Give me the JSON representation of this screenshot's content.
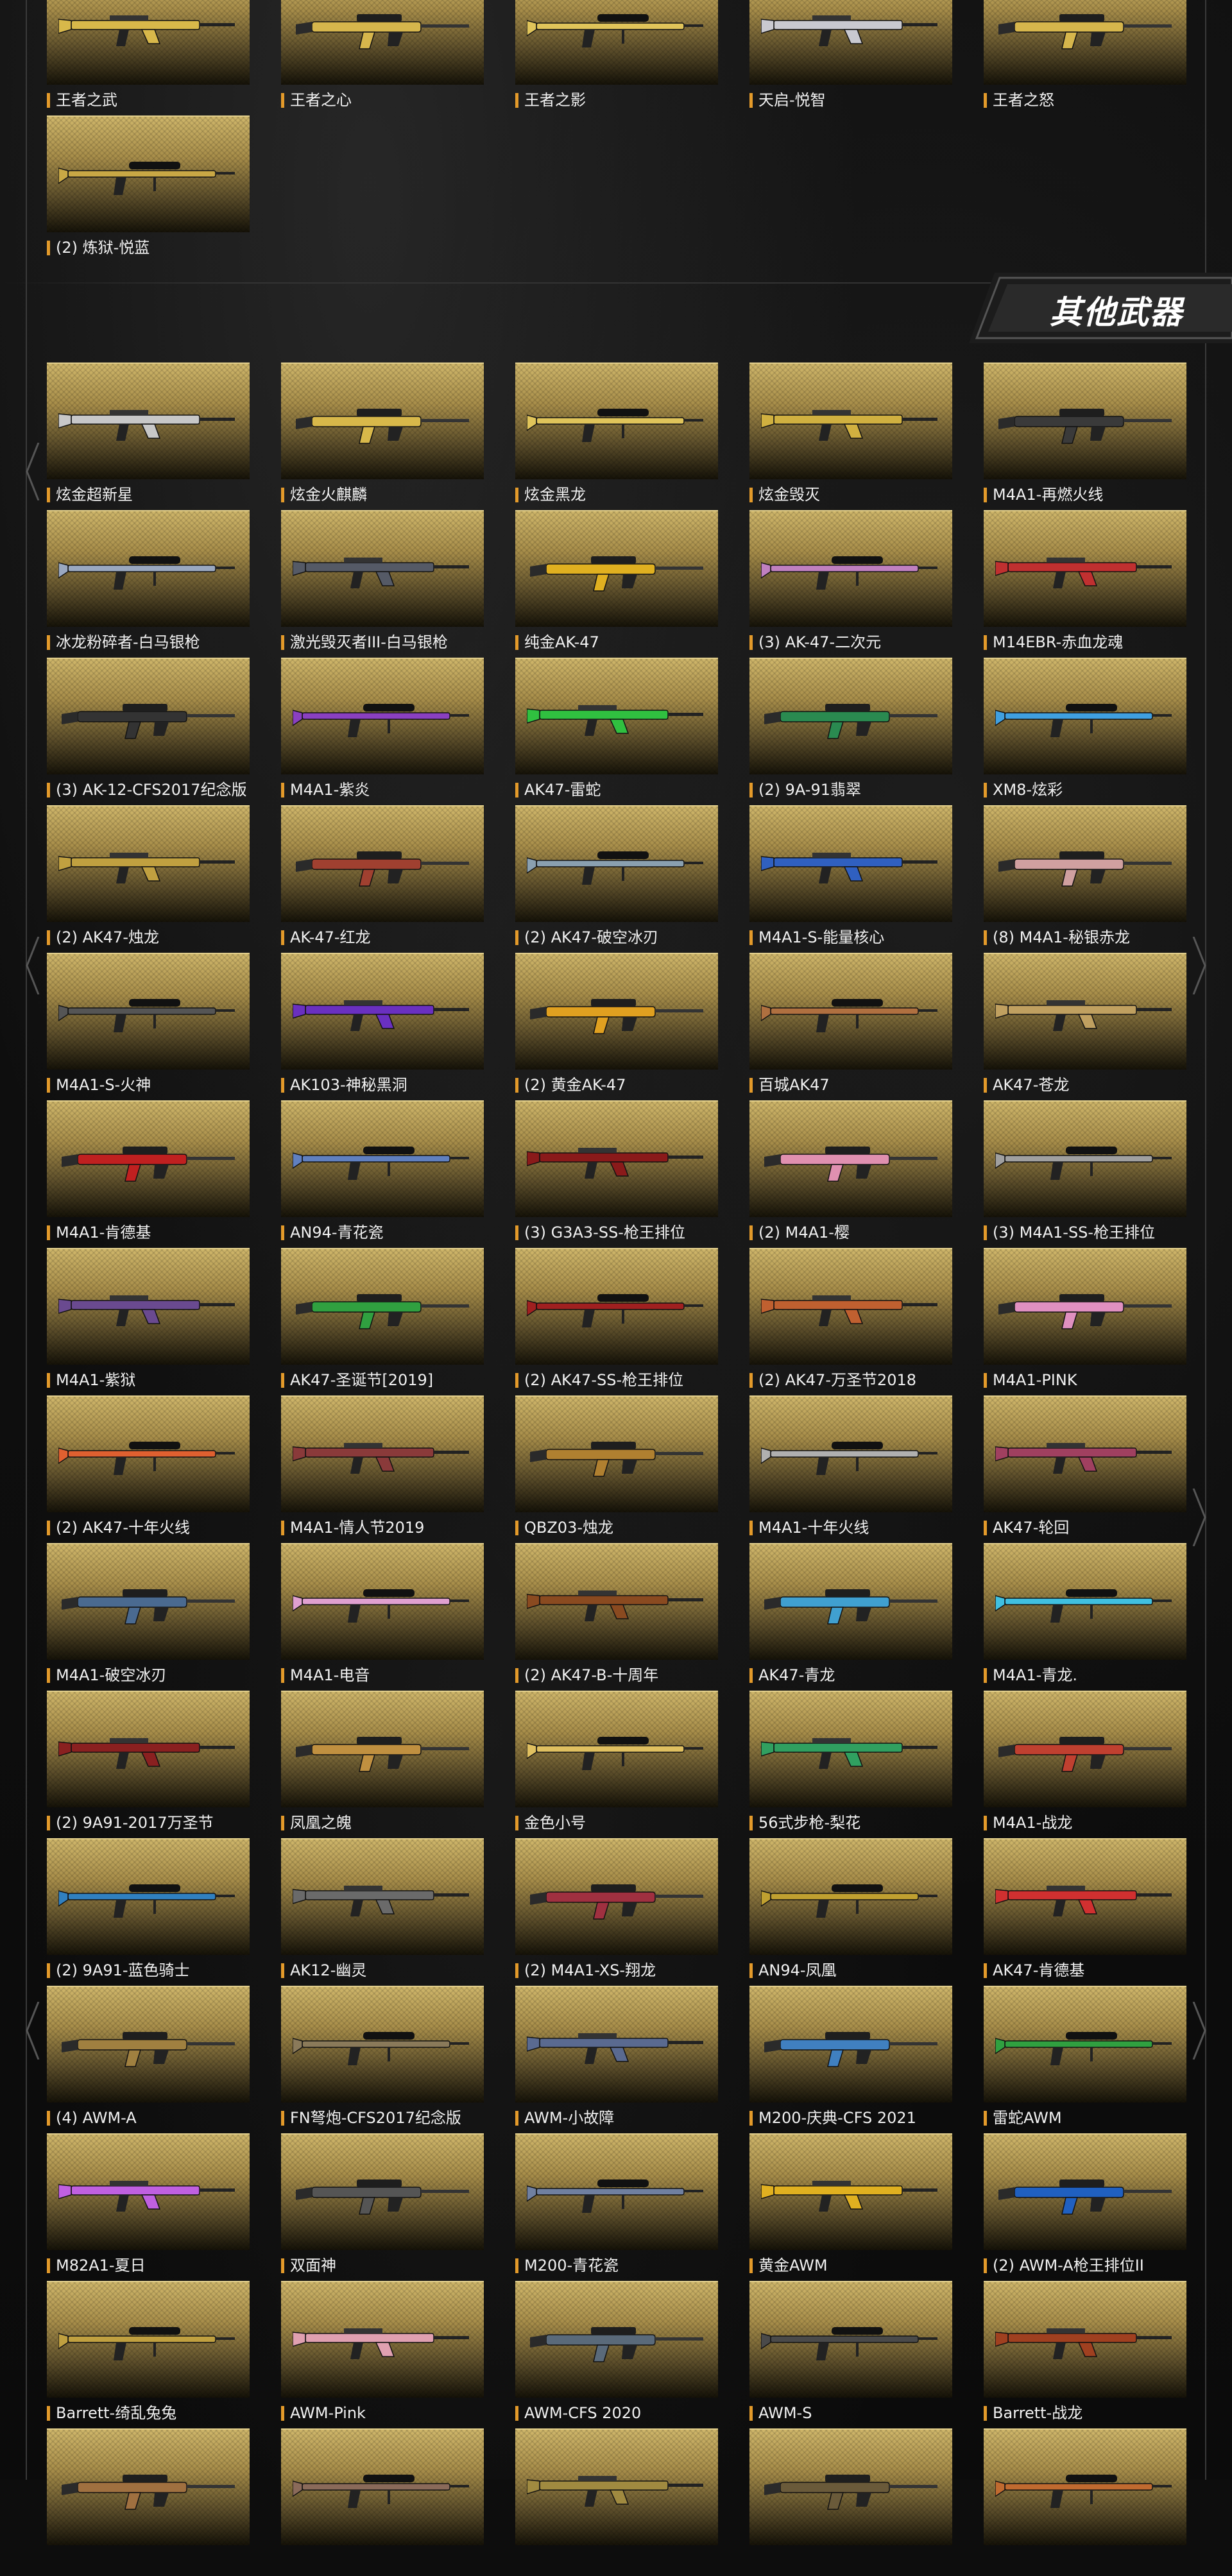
{
  "section_title": "其他武器",
  "colors": {
    "accent": "#e39a2a",
    "card_gold": "#bfa35a",
    "background": "#0d0d0d"
  },
  "top_weapons": [
    {
      "name": "王者之武",
      "color": "#d8b84a"
    },
    {
      "name": "王者之心",
      "color": "#d6b64c"
    },
    {
      "name": "王者之影",
      "color": "#e0c45a"
    },
    {
      "name": "天启-悦智",
      "color": "#c9c9d0"
    },
    {
      "name": "王者之怒",
      "color": "#d6b64c"
    },
    {
      "name": "(2) 炼狱-悦蓝",
      "color": "#c9a845"
    }
  ],
  "other_weapons": [
    {
      "name": "炫金超新星",
      "color": "#c8c8c8"
    },
    {
      "name": "炫金火麒麟",
      "color": "#d8b84a"
    },
    {
      "name": "炫金黑龙",
      "color": "#e0c45a"
    },
    {
      "name": "炫金毁灭",
      "color": "#d0b040"
    },
    {
      "name": "M4A1-再燃火线",
      "color": "#3a3a3a"
    },
    {
      "name": "冰龙粉碎者-白马银枪",
      "color": "#9aa8c0"
    },
    {
      "name": "激光毁灭者III-白马银枪",
      "color": "#555a66"
    },
    {
      "name": "纯金AK-47",
      "color": "#e0b020"
    },
    {
      "name": "(3) AK-47-二次元",
      "color": "#c080c0"
    },
    {
      "name": "M14EBR-赤血龙魂",
      "color": "#c03030"
    },
    {
      "name": "(3) AK-12-CFS2017纪念版",
      "color": "#333333"
    },
    {
      "name": "M4A1-紫炎",
      "color": "#8a40c0"
    },
    {
      "name": "AK47-雷蛇",
      "color": "#30c040"
    },
    {
      "name": "(2) 9A-91翡翠",
      "color": "#2a8a50"
    },
    {
      "name": "XM8-炫彩",
      "color": "#40a0e0"
    },
    {
      "name": "(2) AK47-烛龙",
      "color": "#c0a040"
    },
    {
      "name": "AK-47-红龙",
      "color": "#a04030"
    },
    {
      "name": "(2) AK47-破空冰刃",
      "color": "#8aa0b0"
    },
    {
      "name": "M4A1-S-能量核心",
      "color": "#3060c0"
    },
    {
      "name": "(8) M4A1-秘银赤龙",
      "color": "#d0a0a0"
    },
    {
      "name": "M4A1-S-火神",
      "color": "#555555"
    },
    {
      "name": "AK103-神秘黑洞",
      "color": "#6a30c0"
    },
    {
      "name": "(2) 黄金AK-47",
      "color": "#e0a020"
    },
    {
      "name": "百城AK47",
      "color": "#b07040"
    },
    {
      "name": "AK47-苍龙",
      "color": "#c0a060"
    },
    {
      "name": "M4A1-肯德基",
      "color": "#c02020"
    },
    {
      "name": "AN94-青花瓷",
      "color": "#6080c0"
    },
    {
      "name": "(3) G3A3-SS-枪王排位",
      "color": "#8a1a1a"
    },
    {
      "name": "(2) M4A1-樱",
      "color": "#e090b0"
    },
    {
      "name": "(3) M4A1-SS-枪王排位",
      "color": "#a0a0a0"
    },
    {
      "name": "M4A1-紫狱",
      "color": "#6a4a90"
    },
    {
      "name": "AK47-圣诞节[2019]",
      "color": "#30a040"
    },
    {
      "name": "(2) AK47-SS-枪王排位",
      "color": "#a02020"
    },
    {
      "name": "(2) AK47-万圣节2018",
      "color": "#c06030"
    },
    {
      "name": "M4A1-PINK",
      "color": "#e090c0"
    },
    {
      "name": "(2) AK47-十年火线",
      "color": "#e06030"
    },
    {
      "name": "M4A1-情人节2019",
      "color": "#8a3a3a"
    },
    {
      "name": "QBZ03-烛龙",
      "color": "#b08030"
    },
    {
      "name": "M4A1-十年火线",
      "color": "#b0b0b0"
    },
    {
      "name": "AK47-轮回",
      "color": "#a04060"
    },
    {
      "name": "M4A1-破空冰刃",
      "color": "#4a6a90"
    },
    {
      "name": "M4A1-电音",
      "color": "#e0a0d0"
    },
    {
      "name": "(2) AK47-B-十周年",
      "color": "#8a4a20"
    },
    {
      "name": "AK47-青龙",
      "color": "#40a0d0"
    },
    {
      "name": "M4A1-青龙.",
      "color": "#40c0e0"
    },
    {
      "name": "(2) 9A91-2017万圣节",
      "color": "#8a2020"
    },
    {
      "name": "凤凰之魄",
      "color": "#c09040"
    },
    {
      "name": "金色小号",
      "color": "#e0c060"
    },
    {
      "name": "56式步枪-梨花",
      "color": "#30a060"
    },
    {
      "name": "M4A1-战龙",
      "color": "#c04030"
    },
    {
      "name": "(2) 9A91-蓝色骑士",
      "color": "#3080c0"
    },
    {
      "name": "AK12-幽灵",
      "color": "#6a6a6a"
    },
    {
      "name": "(2) M4A1-XS-翔龙",
      "color": "#a03040"
    },
    {
      "name": "AN94-凤凰",
      "color": "#c0a030"
    },
    {
      "name": "AK47-肯德基",
      "color": "#d03030"
    },
    {
      "name": "(4) AWM-A",
      "color": "#a08040"
    },
    {
      "name": "FN弩炮-CFS2017纪念版",
      "color": "#8a7a5a"
    },
    {
      "name": "AWM-小故障",
      "color": "#5a6a90"
    },
    {
      "name": "M200-庆典-CFS 2021",
      "color": "#4080c0"
    },
    {
      "name": "雷蛇AWM",
      "color": "#30a040"
    },
    {
      "name": "M82A1-夏日",
      "color": "#c060e0"
    },
    {
      "name": "双面神",
      "color": "#555555"
    },
    {
      "name": "M200-青花瓷",
      "color": "#7080a0"
    },
    {
      "name": "黄金AWM",
      "color": "#e0b020"
    },
    {
      "name": "(2) AWM-A枪王排位II",
      "color": "#2060c0"
    },
    {
      "name": "Barrett-绮乱兔兔",
      "color": "#c0a040"
    },
    {
      "name": "AWM-Pink",
      "color": "#e0a0b0"
    },
    {
      "name": "AWM-CFS 2020",
      "color": "#5a6a7a"
    },
    {
      "name": "AWM-S",
      "color": "#4a4a4a"
    },
    {
      "name": "Barrett-战龙",
      "color": "#a04020"
    },
    {
      "name": "",
      "color": "#a07040"
    },
    {
      "name": "",
      "color": "#8a6a5a"
    },
    {
      "name": "",
      "color": "#a08a40"
    },
    {
      "name": "",
      "color": "#6a5a3a"
    },
    {
      "name": "",
      "color": "#c06a30"
    }
  ]
}
